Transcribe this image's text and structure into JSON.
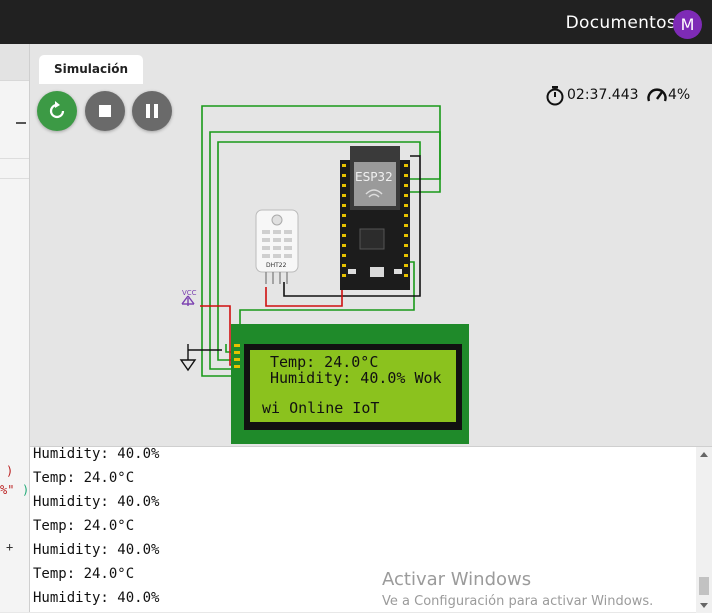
{
  "header": {
    "title": "Documentos",
    "avatar_letter": "M",
    "avatar_color": "#7e2bb6"
  },
  "simulation": {
    "tab_label": "Simulación",
    "timer": "02:37.443",
    "speed": "4%",
    "controls": [
      "restart-icon",
      "stop-icon",
      "pause-icon"
    ],
    "board_label": "ESP32",
    "sensor_label": "DHT22",
    "vcc_label": "VCC",
    "lcd_lines": [
      "Temp: 24.0°C",
      "Humidity: 40.0% Wok",
      "",
      "wi Online IoT"
    ]
  },
  "editor_fragments": [
    ")",
    "%\"",
    ")",
    "+"
  ],
  "serial_monitor": {
    "lines": [
      "Humidity: 40.0%",
      "Temp: 24.0°C",
      "Humidity: 40.0%",
      "Temp: 24.0°C",
      "Humidity: 40.0%",
      "Temp: 24.0°C",
      "Humidity: 40.0%"
    ]
  },
  "watermark": {
    "title": "Activar Windows",
    "subtitle": "Ve a Configuración para activar Windows."
  },
  "colors": {
    "restart_button": "#3c9a45",
    "control_button": "#6a6a6a",
    "lcd_background": "#8bc21e",
    "wire_green": "#1a9a1a",
    "wire_red": "#d01010"
  }
}
